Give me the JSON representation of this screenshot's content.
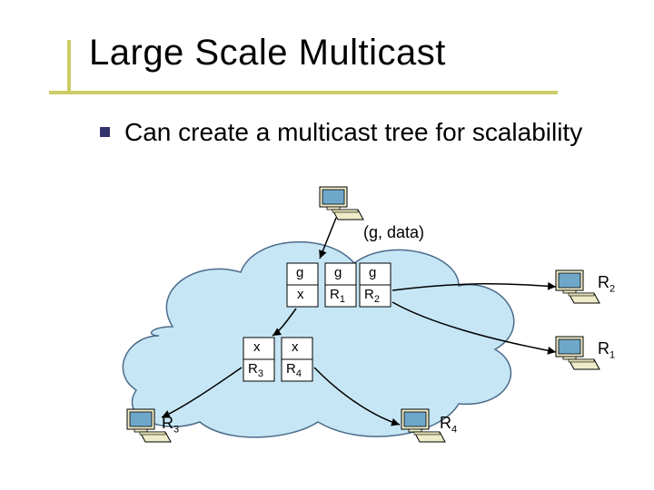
{
  "title": "Large Scale Multicast",
  "bullet": "Can create a multicast tree for scalability",
  "diagram": {
    "packet_label": "(g, data)",
    "tables": {
      "top_left": {
        "r1c1": "g",
        "r2c1": "x"
      },
      "top_mid": {
        "r1c1": "g",
        "r2c1": "R",
        "r2c1_sub": "1"
      },
      "top_right": {
        "r1c1": "g",
        "r2c1": "R",
        "r2c1_sub": "2"
      },
      "mid_left": {
        "r1c1": "x",
        "r2c1": "R",
        "r2c1_sub": "3"
      },
      "mid_right": {
        "r1c1": "x",
        "r2c1": "R",
        "r2c1_sub": "4"
      }
    },
    "hosts": {
      "r2": {
        "label": "R",
        "sub": "2"
      },
      "r1": {
        "label": "R",
        "sub": "1"
      },
      "r3": {
        "label": "R",
        "sub": "3"
      },
      "r4": {
        "label": "R",
        "sub": "4"
      }
    }
  },
  "colors": {
    "accent": "#cccc66",
    "bullet": "#34346c",
    "cloud_fill": "#c6e6f5",
    "cloud_stroke": "#4a6a8a",
    "pc_body": "#efedc9",
    "pc_screen": "#6fa7c9"
  }
}
